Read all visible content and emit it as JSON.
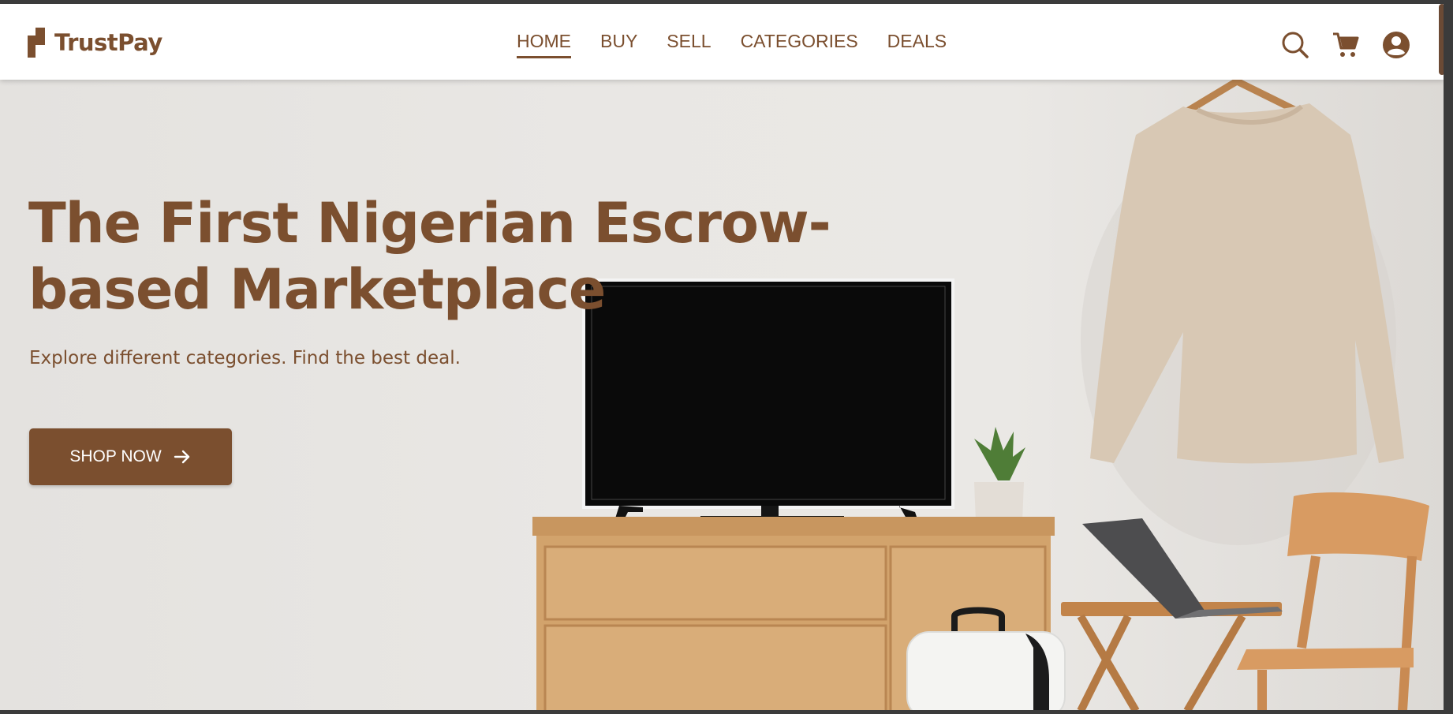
{
  "brand": {
    "name": "TrustPay",
    "color": "#7b4f2f"
  },
  "nav": {
    "items": [
      {
        "label": "HOME",
        "active": true
      },
      {
        "label": "BUY",
        "active": false
      },
      {
        "label": "SELL",
        "active": false
      },
      {
        "label": "CATEGORIES",
        "active": false
      },
      {
        "label": "DEALS",
        "active": false
      }
    ]
  },
  "header_icons": [
    "search-icon",
    "cart-icon",
    "account-icon"
  ],
  "hero": {
    "headline": "The First Nigerian Escrow-based Marketplace",
    "subheadline": "Explore different categories. Find the best deal.",
    "cta_label": "SHOP NOW",
    "cta_icon": "arrow-right-icon"
  }
}
